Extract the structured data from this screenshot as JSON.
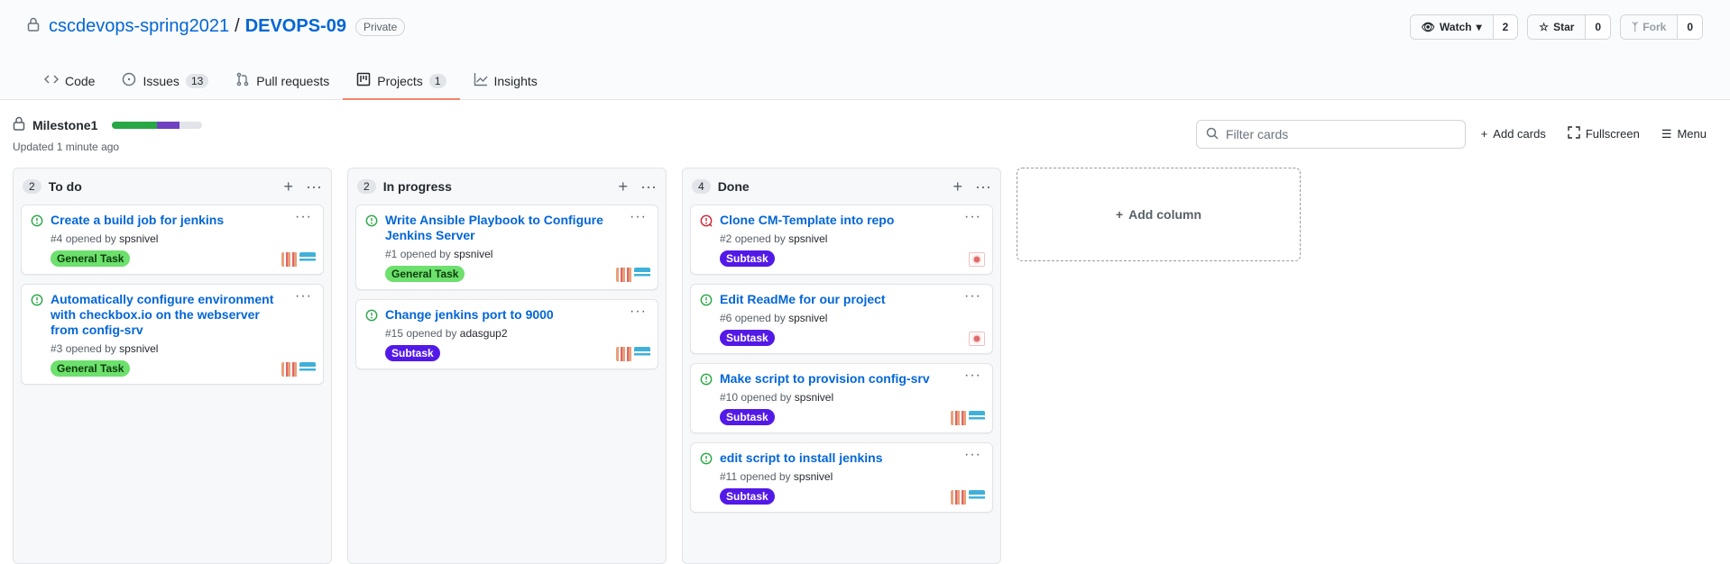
{
  "repo": {
    "owner": "cscdevops-spring2021",
    "sep": "/",
    "name": "DEVOPS-09",
    "visibility": "Private"
  },
  "actions": {
    "watch": {
      "label": "Watch",
      "count": "2"
    },
    "star": {
      "label": "Star",
      "count": "0"
    },
    "fork": {
      "label": "Fork",
      "count": "0"
    }
  },
  "tabs": [
    {
      "label": "Code",
      "count": ""
    },
    {
      "label": "Issues",
      "count": "13"
    },
    {
      "label": "Pull requests",
      "count": ""
    },
    {
      "label": "Projects",
      "count": "1"
    },
    {
      "label": "Insights",
      "count": ""
    }
  ],
  "project": {
    "name": "Milestone1",
    "updated": "Updated 1 minute ago",
    "progress": {
      "done": 0.5,
      "in_progress": 0.25
    }
  },
  "filter": {
    "placeholder": "Filter cards"
  },
  "tools": {
    "add_cards": "Add cards",
    "fullscreen": "Fullscreen",
    "menu": "Menu"
  },
  "columns": [
    {
      "count": "2",
      "name": "To do",
      "cards": [
        {
          "title": "Create a build job for jenkins",
          "number": "#4",
          "opened": "opened by",
          "user": "spsnivel",
          "label": "General Task"
        },
        {
          "title": "Automatically configure environment with checkbox.io on the webserver from config-srv",
          "number": "#3",
          "opened": "opened by",
          "user": "spsnivel",
          "label": "General Task"
        }
      ]
    },
    {
      "count": "2",
      "name": "In progress",
      "cards": [
        {
          "title": "Write Ansible Playbook to Configure Jenkins Server",
          "number": "#1",
          "opened": "opened by",
          "user": "spsnivel",
          "label": "General Task"
        },
        {
          "title": "Change jenkins port to 9000",
          "number": "#15",
          "opened": "opened by",
          "user": "adasgup2",
          "label": "Subtask"
        }
      ]
    },
    {
      "count": "4",
      "name": "Done",
      "cards": [
        {
          "title": "Clone CM-Template into repo",
          "number": "#2",
          "opened": "opened by",
          "user": "spsnivel",
          "label": "Subtask"
        },
        {
          "title": "Edit ReadMe for our project",
          "number": "#6",
          "opened": "opened by",
          "user": "spsnivel",
          "label": "Subtask"
        },
        {
          "title": "Make script to provision config-srv",
          "number": "#10",
          "opened": "opened by",
          "user": "spsnivel",
          "label": "Subtask"
        },
        {
          "title": "edit script to install jenkins",
          "number": "#11",
          "opened": "opened by",
          "user": "spsnivel",
          "label": "Subtask"
        }
      ]
    }
  ],
  "add_column": "Add column",
  "colors": {
    "accent": "#0366d6",
    "open_issue": "#28a745",
    "closed_issue": "#cb2431",
    "general_task": "#6de06d",
    "subtask": "#5319e7",
    "tab_underline": "#f9826c"
  }
}
